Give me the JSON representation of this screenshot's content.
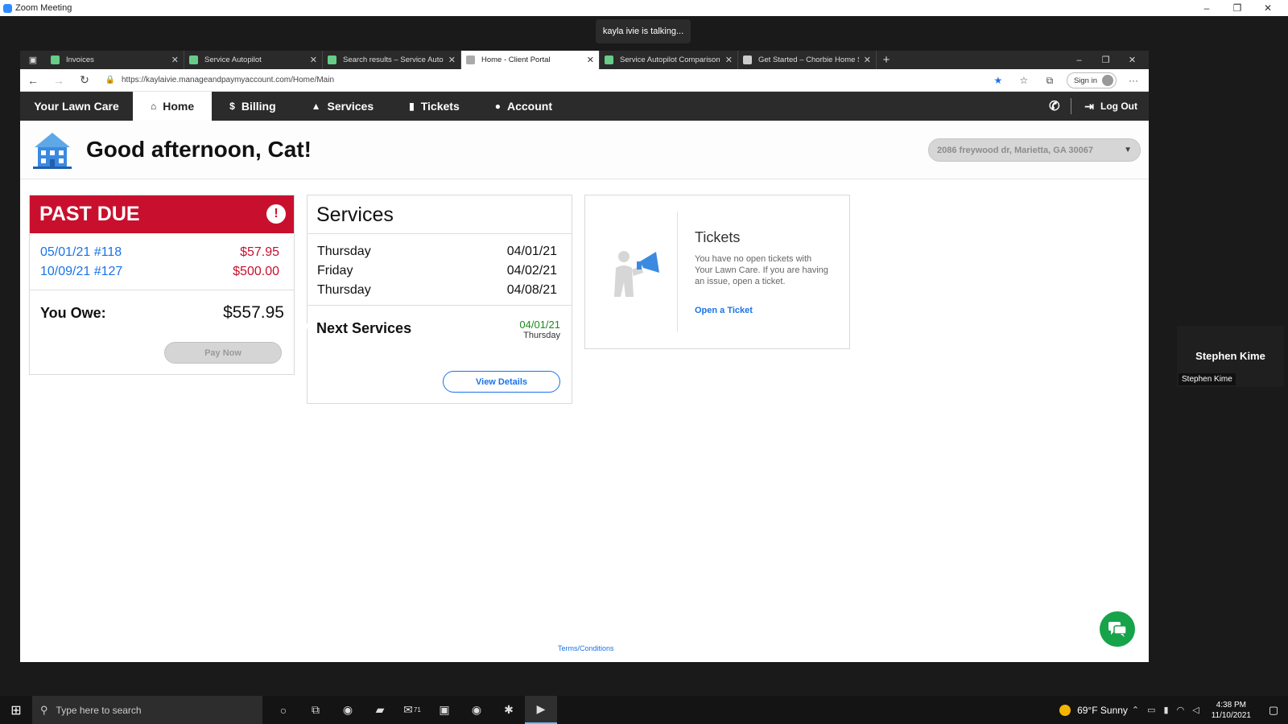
{
  "zoom": {
    "title": "Zoom Meeting",
    "talking": "kayla ivie is talking...",
    "window_controls": [
      "–",
      "❐",
      "✕"
    ]
  },
  "browser": {
    "tabs": [
      {
        "label": "Invoices"
      },
      {
        "label": "Service Autopilot"
      },
      {
        "label": "Search results – Service Autopilo"
      },
      {
        "label": "Home - Client Portal"
      },
      {
        "label": "Service Autopilot Comparison Cl"
      },
      {
        "label": "Get Started – Chorbie Home Ser"
      }
    ],
    "url": "https://kaylaivie.manageandpaymyaccount.com/Home/Main",
    "signin": "Sign in"
  },
  "site": {
    "brand": "Your Lawn Care",
    "nav": [
      {
        "label": "Home",
        "icon": "home-icon"
      },
      {
        "label": "Billing",
        "icon": "billing-icon"
      },
      {
        "label": "Services",
        "icon": "services-icon"
      },
      {
        "label": "Tickets",
        "icon": "tickets-icon"
      },
      {
        "label": "Account",
        "icon": "account-icon"
      }
    ],
    "logout": "Log Out",
    "greeting": "Good afternoon, Cat!",
    "address": "2086 freywood dr, Marietta, GA 30067"
  },
  "past_due": {
    "title": "PAST DUE",
    "invoices": [
      {
        "label": "05/01/21 #118",
        "amount": "$57.95"
      },
      {
        "label": "10/09/21 #127",
        "amount": "$500.00"
      }
    ],
    "owe_label": "You Owe:",
    "owe_value": "$557.95",
    "pay_button": "Pay Now"
  },
  "services": {
    "title": "Services",
    "rows": [
      {
        "day": "Thursday",
        "date": "04/01/21"
      },
      {
        "day": "Friday",
        "date": "04/02/21"
      },
      {
        "day": "Thursday",
        "date": "04/08/21"
      }
    ],
    "next_label": "Next Services",
    "next_date": "04/01/21",
    "next_day": "Thursday",
    "view_button": "View Details"
  },
  "tickets": {
    "title": "Tickets",
    "text": "You have no open tickets with Your Lawn Care. If you are having an issue, open a ticket.",
    "link": "Open a Ticket"
  },
  "footer": {
    "terms": "Terms/Conditions"
  },
  "participant": {
    "name": "Stephen Kime",
    "tag": "Stephen Kime"
  },
  "taskbar": {
    "search_placeholder": "Type here to search",
    "weather": "69°F  Sunny",
    "time": "4:38 PM",
    "date": "11/10/2021",
    "badge": "71"
  },
  "colors": {
    "accent": "#1a73e8",
    "past_due_red": "#c8102e",
    "chat_green": "#17a34a"
  }
}
